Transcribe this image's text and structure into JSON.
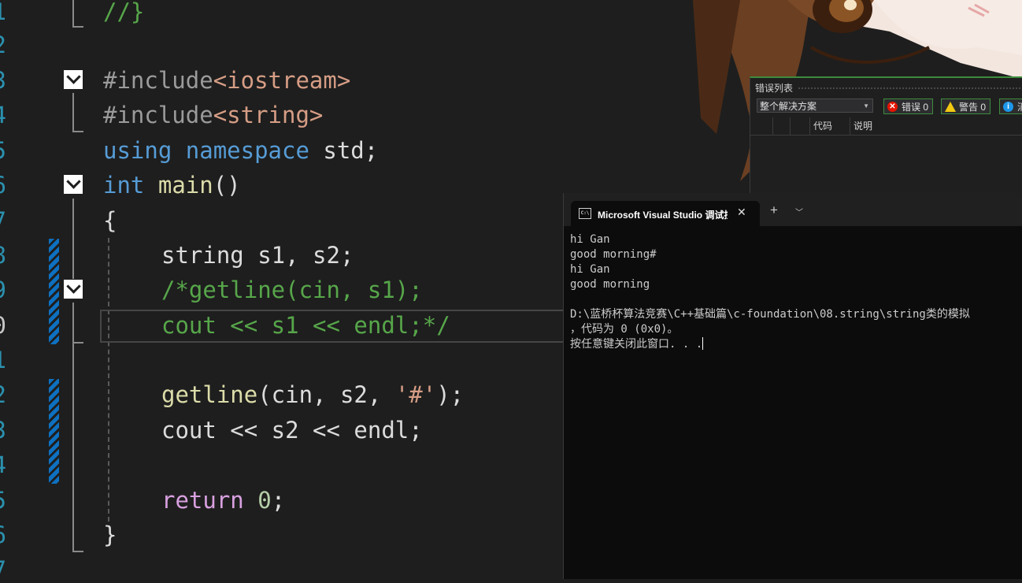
{
  "editor": {
    "line_numbers": [
      "1",
      "2",
      "3",
      "4",
      "5",
      "6",
      "7",
      "8",
      "9",
      "0",
      "1",
      "2",
      "3",
      "4",
      "5",
      "6",
      "7"
    ],
    "lines": {
      "l1": "//}",
      "l3_a": "#include",
      "l3_b": "<iostream>",
      "l4_a": "#include",
      "l4_b": "<string>",
      "l5_a": "using",
      "l5_b": "namespace",
      "l5_c": "std;",
      "l6_a": "int",
      "l6_b": "main",
      "l6_c": "()",
      "l7": "{",
      "l8": "string s1, s2;",
      "l9": "/*getline(cin, s1);",
      "l10": "cout << s1 << endl;*/",
      "l12_a": "getline",
      "l12_b": "(cin, s2, ",
      "l12_c": "'#'",
      "l12_d": ");",
      "l13": "cout << s2 << endl;",
      "l15_a": "return",
      "l15_b": "0",
      "l15_c": ";",
      "l16": "}"
    }
  },
  "error_list": {
    "title": "错误列表",
    "scope": "整个解决方案",
    "errors_label": "错误 0",
    "warnings_label": "警告 0",
    "messages_label": "消",
    "col_code": "代码",
    "col_desc": "说明"
  },
  "console": {
    "tab_title": "Microsoft Visual Studio 调试控制台",
    "new_tab": "+",
    "dropdown": "⌄",
    "output": [
      "hi Gan",
      "good morning#",
      "hi Gan",
      "good morning",
      "",
      "D:\\蓝桥杯算法竞赛\\C++基础篇\\c-foundation\\08.string\\string类的模拟",
      "，代码为 0 (0x0)。",
      "按任意键关闭此窗口. . ."
    ]
  },
  "colors": {
    "editor_bg": "#1e1e1e",
    "keyword": "#569cd6",
    "function": "#dcdcaa",
    "string": "#d69d85",
    "comment": "#57a64a",
    "line_number": "#2b91af",
    "console_bg": "#0c0c0c"
  }
}
